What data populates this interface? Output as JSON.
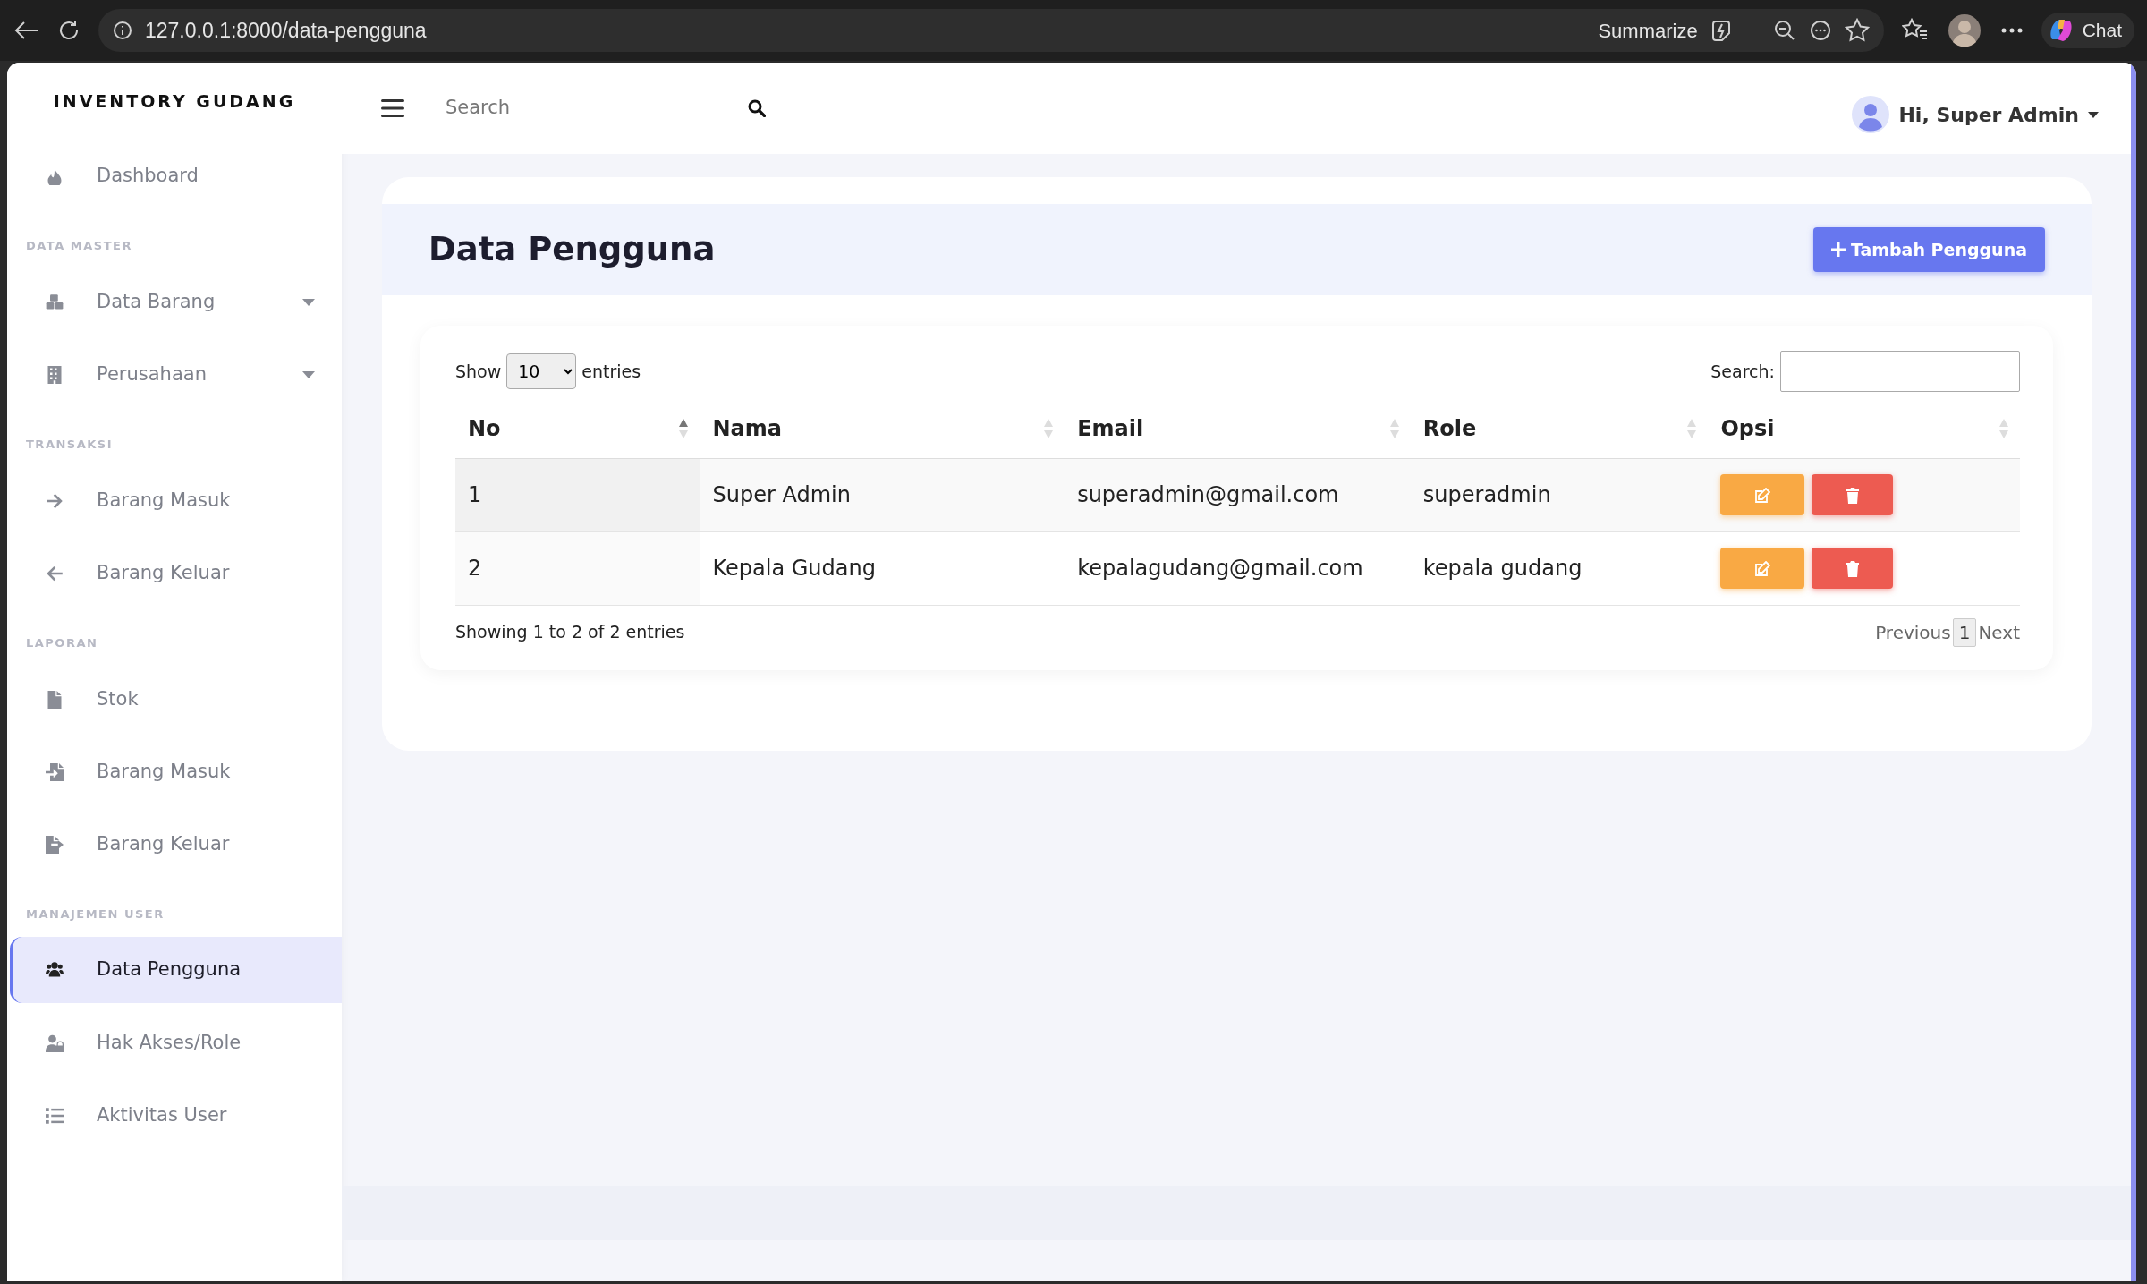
{
  "browser": {
    "url": "127.0.0.1:8000/data-pengguna",
    "summarize": "Summarize",
    "chat": "Chat"
  },
  "sidebar": {
    "brand": "INVENTORY GUDANG",
    "sections": [
      {
        "items": [
          {
            "label": "Dashboard",
            "has_submenu": false,
            "selected": false
          }
        ]
      },
      {
        "heading": "DATA MASTER",
        "items": [
          {
            "label": "Data Barang",
            "has_submenu": true,
            "selected": false
          },
          {
            "label": "Perusahaan",
            "has_submenu": true,
            "selected": false
          }
        ]
      },
      {
        "heading": "TRANSAKSI",
        "items": [
          {
            "label": "Barang Masuk",
            "has_submenu": false,
            "selected": false
          },
          {
            "label": "Barang Keluar",
            "has_submenu": false,
            "selected": false
          }
        ]
      },
      {
        "heading": "LAPORAN",
        "items": [
          {
            "label": "Stok",
            "has_submenu": false,
            "selected": false
          },
          {
            "label": "Barang Masuk",
            "has_submenu": false,
            "selected": false
          },
          {
            "label": "Barang Keluar",
            "has_submenu": false,
            "selected": false
          }
        ]
      },
      {
        "heading": "MANAJEMEN USER",
        "items": [
          {
            "label": "Data Pengguna",
            "has_submenu": false,
            "selected": true
          },
          {
            "label": "Hak Akses/Role",
            "has_submenu": false,
            "selected": false
          },
          {
            "label": "Aktivitas User",
            "has_submenu": false,
            "selected": false
          }
        ]
      }
    ]
  },
  "topbar": {
    "search": {
      "placeholder": "Search"
    },
    "user": "Hi, Super Admin"
  },
  "page": {
    "title": "Data Pengguna",
    "add_button": "Tambah Pengguna"
  },
  "table": {
    "show_label": "Show",
    "page_size": "10",
    "entries_label": "entries",
    "search_label": "Search:",
    "columns": [
      {
        "label": "No",
        "sorted": true
      },
      {
        "label": "Nama",
        "sorted": false
      },
      {
        "label": "Email",
        "sorted": false
      },
      {
        "label": "Role",
        "sorted": false
      },
      {
        "label": "Opsi",
        "sorted": false
      }
    ],
    "rows": [
      {
        "cells": [
          "1",
          "Super Admin",
          "superadmin@gmail.com",
          "superadmin"
        ]
      },
      {
        "cells": [
          "2",
          "Kepala Gudang",
          "kepalagudang@gmail.com",
          "kepala gudang"
        ]
      }
    ],
    "info": "Showing 1 to 2 of 2 entries",
    "pagination": {
      "previous": "Previous",
      "pages": [
        {
          "label": "1",
          "selected": true
        }
      ],
      "next": "Next"
    }
  }
}
